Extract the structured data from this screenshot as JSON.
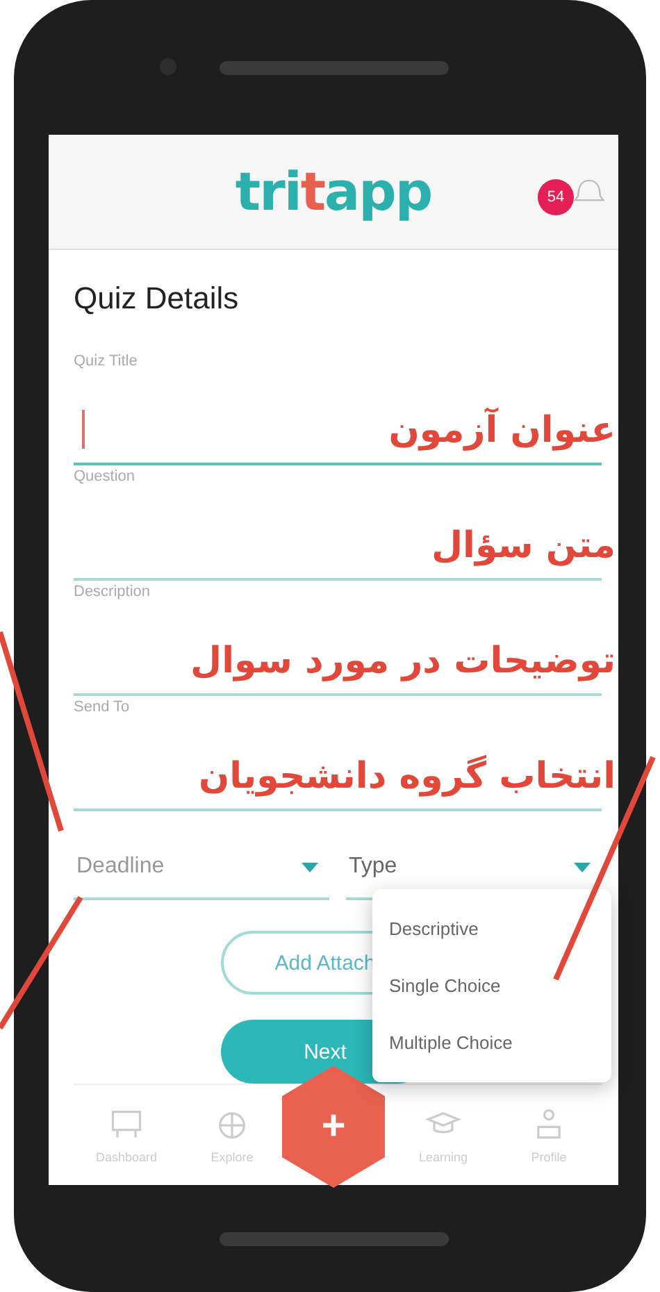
{
  "logo": [
    {
      "text": "tri",
      "color": "#2bb0ae"
    },
    {
      "text": "t",
      "color": "#e8614f"
    },
    {
      "text": "app",
      "color": "#2bb0ae"
    }
  ],
  "notifications": {
    "badge": "54"
  },
  "title": "Quiz Details",
  "fields": [
    {
      "label": "Quiz Title",
      "focused": true,
      "annotation": "عنوان آزمون"
    },
    {
      "label": "Question",
      "focused": false,
      "annotation": "متن سؤال"
    },
    {
      "label": "Description",
      "focused": false,
      "annotation": "توضیحات در مورد سوال"
    },
    {
      "label": "Send To",
      "focused": false,
      "annotation": "انتخاب گروه دانشجویان"
    }
  ],
  "selects": [
    {
      "placeholder": "Deadline",
      "open": false
    },
    {
      "placeholder": "Type",
      "open": true
    }
  ],
  "buttons": [
    {
      "label": "Add Attach",
      "kind": "outline"
    },
    {
      "label": "Next",
      "kind": "filled"
    }
  ],
  "dropdown": {
    "options": [
      "Descriptive",
      "Single Choice",
      "Multiple Choice"
    ]
  },
  "nav": [
    {
      "label": "Dashboard"
    },
    {
      "label": "Explore"
    },
    {
      "label": "Learning"
    },
    {
      "label": "Profile"
    }
  ],
  "fab": {
    "label": "+"
  }
}
